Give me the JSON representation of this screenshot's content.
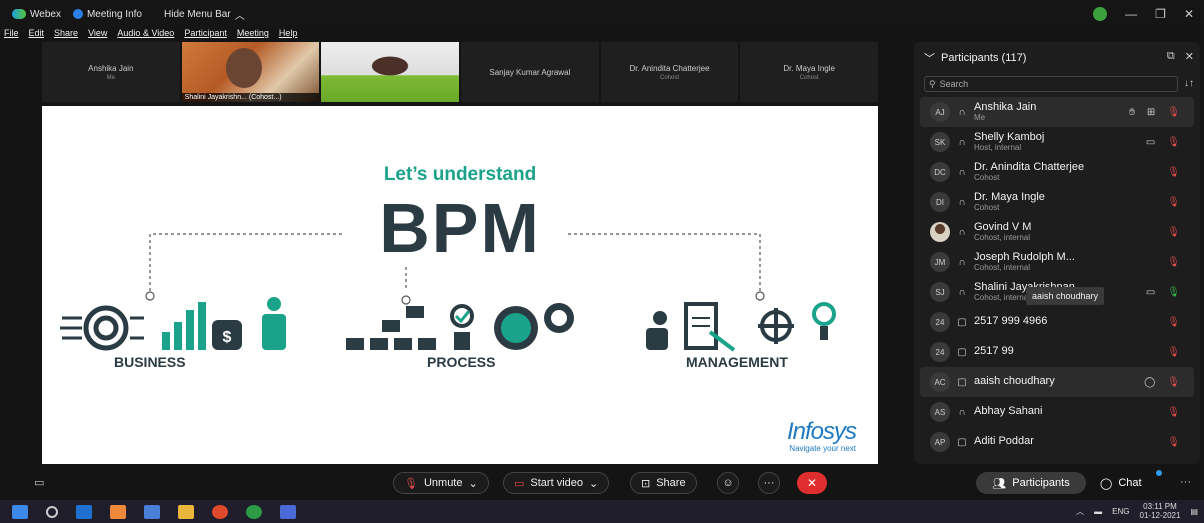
{
  "titlebar": {
    "app": "Webex",
    "meeting_info": "Meeting Info",
    "hide_menu": "Hide Menu Bar",
    "chevron": "︿",
    "minimize": "—",
    "restore": "❐",
    "close": "✕"
  },
  "menu": [
    "File",
    "Edit",
    "Share",
    "View",
    "Audio & Video",
    "Participant",
    "Meeting",
    "Help"
  ],
  "thumbnails": [
    {
      "name": "Anshika Jain",
      "sub": "Me",
      "video": false
    },
    {
      "name": "Shalini Jayakrishn... (Cohost...)",
      "sub": "",
      "video": true,
      "active": true
    },
    {
      "name": "",
      "sub": "",
      "video": true
    },
    {
      "name": "Sanjay Kumar Agrawal",
      "sub": "",
      "video": false
    },
    {
      "name": "Dr. Anindita Chatterjee",
      "sub": "Cohost",
      "video": false
    },
    {
      "name": "Dr. Maya Ingle",
      "sub": "Cohost",
      "video": false
    }
  ],
  "slide": {
    "heading": "Let’s understand",
    "title": "BPM",
    "captions": [
      "BUSINESS",
      "PROCESS",
      "MANAGEMENT"
    ],
    "brand": "Infosys",
    "tagline": "Navigate your next",
    "accent_color": "#1aa38a",
    "dark_color": "#2b3b44"
  },
  "panel": {
    "title": "Participants (117)",
    "search_placeholder": "Search",
    "tooltip": "aaish choudhary",
    "participants": [
      {
        "initials": "AJ",
        "name": "Anshika Jain",
        "role": "Me",
        "device": "headset",
        "icons": [
          "raise-hand",
          "captions"
        ],
        "mic": "off"
      },
      {
        "initials": "SK",
        "name": "Shelly Kamboj",
        "role": "Host, internal",
        "device": "headset",
        "icons": [
          "video"
        ],
        "mic": "off"
      },
      {
        "initials": "DC",
        "name": "Dr. Anindita Chatterjee",
        "role": "Cohost",
        "device": "headset",
        "icons": [],
        "mic": "off"
      },
      {
        "initials": "DI",
        "name": "Dr. Maya Ingle",
        "role": "Cohost",
        "device": "headset",
        "icons": [],
        "mic": "off"
      },
      {
        "initials": "",
        "name": "Govind V M",
        "role": "Cohost, internal",
        "device": "headset",
        "icons": [],
        "mic": "off",
        "photo": true
      },
      {
        "initials": "JM",
        "name": "Joseph Rudolph M...",
        "role": "Cohost, internal",
        "device": "headset",
        "icons": [],
        "mic": "off"
      },
      {
        "initials": "SJ",
        "name": "Shalini Jayakrishnan",
        "role": "Cohost, internal",
        "device": "headset",
        "icons": [
          "video"
        ],
        "mic": "on"
      },
      {
        "initials": "24",
        "name": "2517 999 4966",
        "role": "",
        "device": "phone",
        "icons": [],
        "mic": "off"
      },
      {
        "initials": "24",
        "name": "2517 99",
        "role": "",
        "device": "phone",
        "icons": [],
        "mic": "off"
      },
      {
        "initials": "AC",
        "name": "aaish choudhary",
        "role": "",
        "device": "phone",
        "icons": [
          "chat"
        ],
        "mic": "off",
        "highlight": true
      },
      {
        "initials": "AS",
        "name": "Abhay Sahani",
        "role": "",
        "device": "headset",
        "icons": [],
        "mic": "off"
      },
      {
        "initials": "AP",
        "name": "Aditi Poddar",
        "role": "",
        "device": "phone",
        "icons": [],
        "mic": "off"
      }
    ]
  },
  "controls": {
    "unmute": "Unmute",
    "start_video": "Start video",
    "share": "Share",
    "participants": "Participants",
    "chat": "Chat",
    "more": "···"
  },
  "taskbar": {
    "lang": "ENG",
    "time": "03:11 PM",
    "date": "01-12-2021"
  }
}
